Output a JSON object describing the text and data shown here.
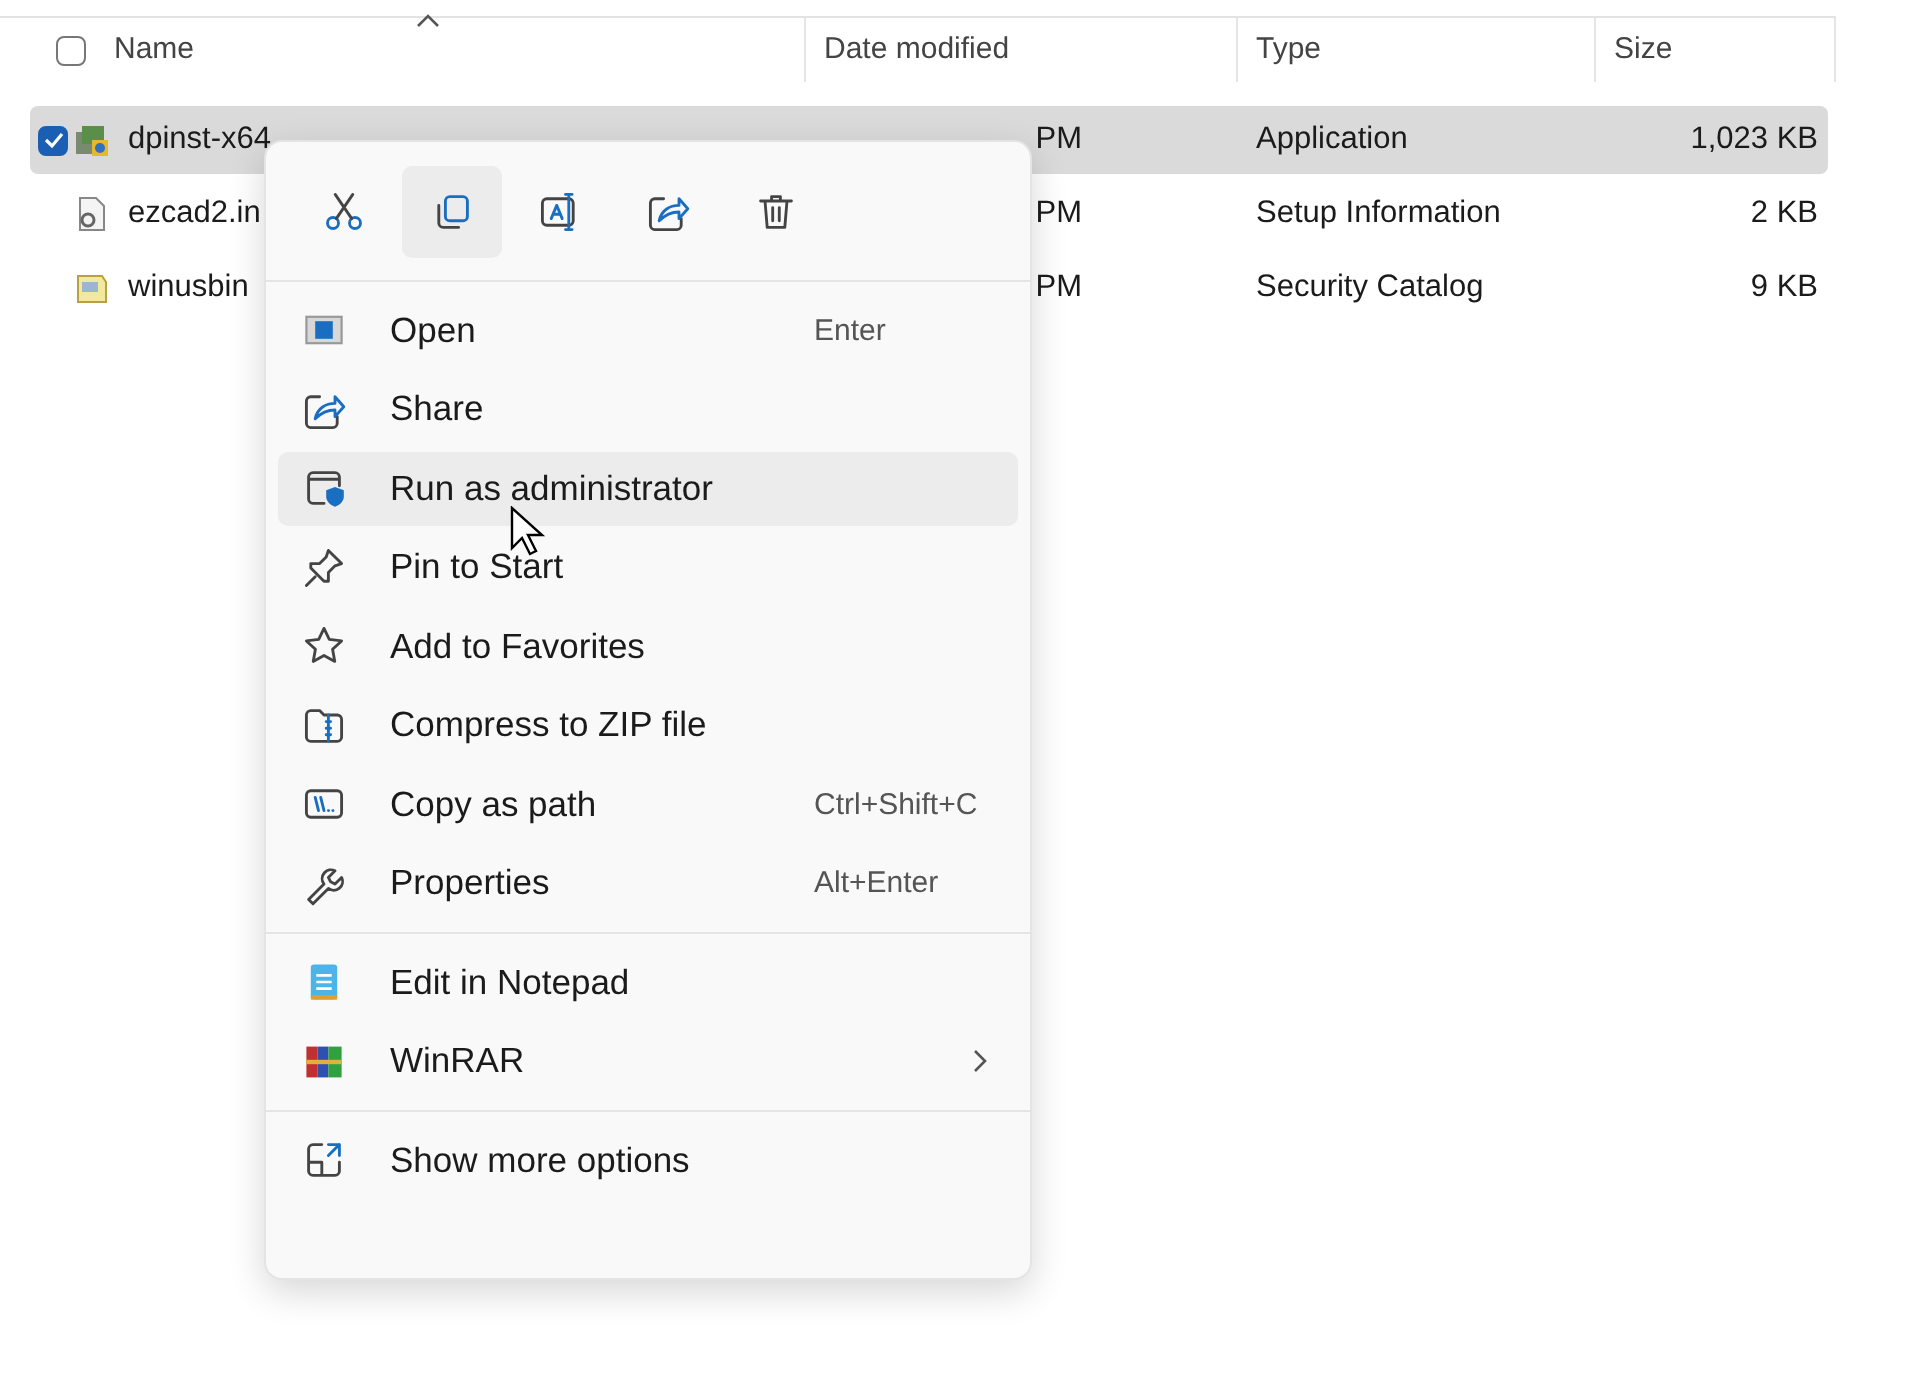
{
  "table": {
    "select_all": {
      "checked": false
    },
    "columns": [
      {
        "label": "Name",
        "sorted": true
      },
      {
        "label": "Date modified",
        "sorted": false
      },
      {
        "label": "Type",
        "sorted": false
      },
      {
        "label": "Size",
        "sorted": false
      }
    ],
    "rows": [
      {
        "kind": "application",
        "selected": true,
        "checked": true,
        "name": "dpinst-x64",
        "date": "PM",
        "type": "Application",
        "size": "1,023 KB"
      },
      {
        "kind": "setup",
        "selected": false,
        "checked": false,
        "name": "ezcad2.in",
        "date": "PM",
        "type": "Setup Information",
        "size": "2 KB"
      },
      {
        "kind": "catalog",
        "selected": false,
        "checked": false,
        "name": "winusbin",
        "date": "PM",
        "type": "Security Catalog",
        "size": "9 KB"
      }
    ]
  },
  "context_menu": {
    "toolbar": [
      {
        "kind": "cut",
        "selected": false
      },
      {
        "kind": "copy",
        "selected": true
      },
      {
        "kind": "rename",
        "selected": false
      },
      {
        "kind": "share",
        "selected": false
      },
      {
        "kind": "delete",
        "selected": false
      }
    ],
    "sections": [
      {
        "items": [
          {
            "kind": "open",
            "label": "Open",
            "shortcut": "Enter",
            "selected": false
          },
          {
            "kind": "share",
            "label": "Share",
            "selected": false
          },
          {
            "kind": "admin",
            "label": "Run as administrator",
            "selected": true
          },
          {
            "kind": "pin",
            "label": "Pin to Start",
            "selected": false
          },
          {
            "kind": "star",
            "label": "Add to Favorites",
            "selected": false
          },
          {
            "kind": "zip",
            "label": "Compress to ZIP file",
            "selected": false
          },
          {
            "kind": "path",
            "label": "Copy as path",
            "shortcut": "Ctrl+Shift+C",
            "selected": false
          },
          {
            "kind": "wrench",
            "label": "Properties",
            "shortcut": "Alt+Enter",
            "selected": false
          }
        ]
      },
      {
        "items": [
          {
            "kind": "notepad",
            "label": "Edit in Notepad",
            "selected": false
          },
          {
            "kind": "winrar",
            "label": "WinRAR",
            "selected": false,
            "submenu": true
          }
        ]
      },
      {
        "items": [
          {
            "kind": "more",
            "label": "Show more options",
            "selected": false
          }
        ]
      }
    ]
  }
}
